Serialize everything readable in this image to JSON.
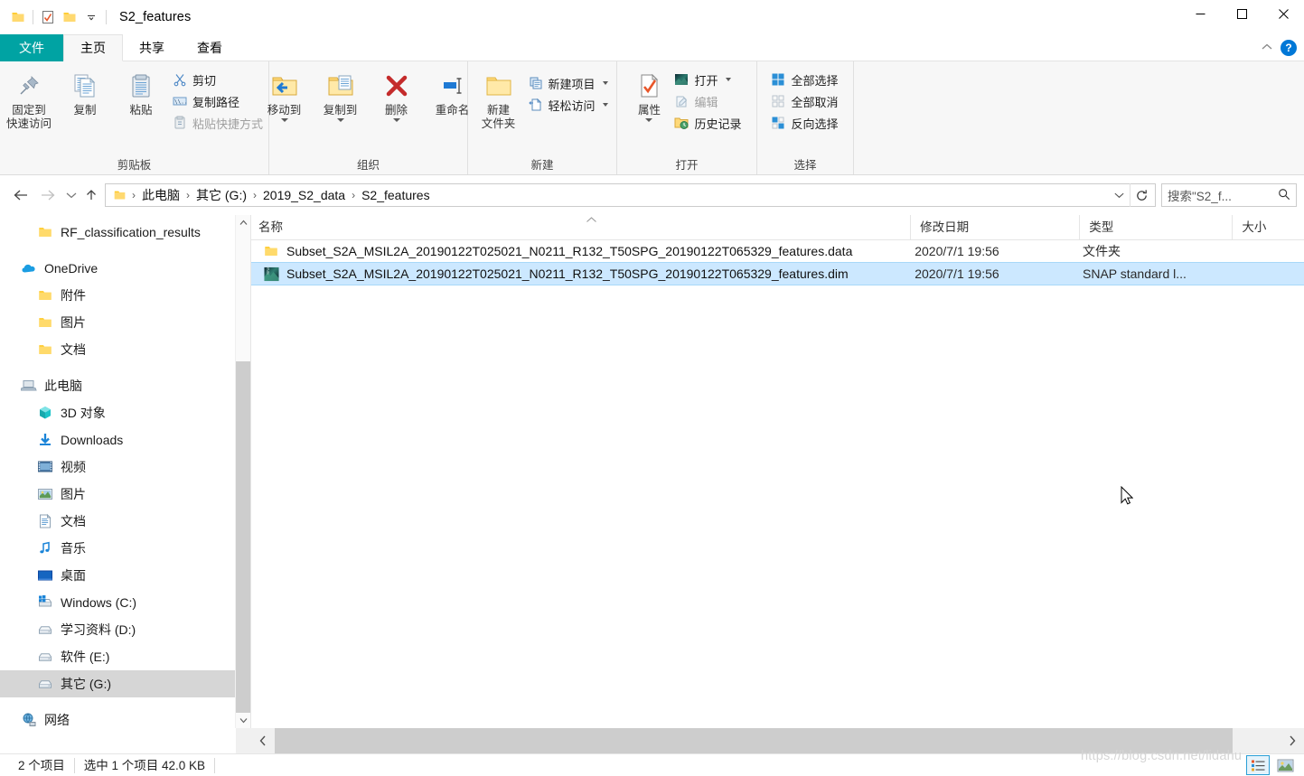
{
  "window": {
    "title": "S2_features",
    "quick_access": [
      "folder-icon",
      "properties-check-icon",
      "new-folder-icon",
      "dropdown-caret"
    ],
    "minimize_label": "—",
    "maximize_label": "□",
    "close_label": "✕",
    "collapse_ribbon_label": "⌃",
    "help_label": "?"
  },
  "tabs": [
    {
      "label": "文件",
      "kind": "file"
    },
    {
      "label": "主页",
      "kind": "active"
    },
    {
      "label": "共享",
      "kind": "normal"
    },
    {
      "label": "查看",
      "kind": "normal"
    }
  ],
  "ribbon": {
    "groups": [
      {
        "title": "剪贴板",
        "big": [
          {
            "label": "固定到\n快速访问",
            "label_line1": "固定到",
            "label_line2": "快速访问",
            "icon": "pin-icon"
          },
          {
            "label": "复制",
            "icon": "copy-icon"
          },
          {
            "label": "粘贴",
            "icon": "paste-icon"
          }
        ],
        "small": [
          {
            "label": "剪切",
            "icon": "scissors-icon",
            "disabled": false
          },
          {
            "label": "复制路径",
            "icon": "copy-path-icon",
            "disabled": false
          },
          {
            "label": "粘贴快捷方式",
            "icon": "paste-shortcut-icon",
            "disabled": true
          }
        ]
      },
      {
        "title": "组织",
        "big": [
          {
            "label": "移动到",
            "icon": "move-to-icon",
            "caret": true
          },
          {
            "label": "复制到",
            "icon": "copy-to-icon",
            "caret": true
          },
          {
            "label": "删除",
            "icon": "delete-icon",
            "caret": true
          },
          {
            "label": "重命名",
            "icon": "rename-icon",
            "caret": false
          }
        ],
        "small": []
      },
      {
        "title": "新建",
        "big": [
          {
            "label_line1": "新建",
            "label_line2": "文件夹",
            "icon": "new-folder-icon"
          }
        ],
        "small": [
          {
            "label": "新建项目",
            "icon": "new-item-icon",
            "caret": true
          },
          {
            "label": "轻松访问",
            "icon": "easy-access-icon",
            "caret": true
          }
        ]
      },
      {
        "title": "打开",
        "big": [
          {
            "label": "属性",
            "icon": "properties-icon",
            "caret": true
          }
        ],
        "small": [
          {
            "label": "打开",
            "icon": "snap-open-icon",
            "caret": true
          },
          {
            "label": "编辑",
            "icon": "edit-icon",
            "disabled": true
          },
          {
            "label": "历史记录",
            "icon": "history-icon"
          }
        ]
      },
      {
        "title": "选择",
        "big": [],
        "small": [
          {
            "label": "全部选择",
            "icon": "select-all-icon"
          },
          {
            "label": "全部取消",
            "icon": "select-none-icon"
          },
          {
            "label": "反向选择",
            "icon": "invert-selection-icon"
          }
        ]
      }
    ]
  },
  "address": {
    "back_label": "←",
    "forward_label": "→",
    "recent_label": "⌄",
    "up_label": "↑",
    "breadcrumbs": [
      "此电脑",
      "其它 (G:)",
      "2019_S2_data",
      "S2_features"
    ],
    "separator": "›",
    "dropdown_label": "⌄",
    "refresh_label": "↻",
    "search_placeholder": "搜索\"S2_f...",
    "search_value": ""
  },
  "sidebar": {
    "items": [
      {
        "label": "RF_classification_results",
        "icon": "folder-icon",
        "indent": 1,
        "selected": false,
        "gap_after": true
      },
      {
        "label": "OneDrive",
        "icon": "onedrive-icon",
        "indent": 0,
        "selected": false
      },
      {
        "label": "附件",
        "icon": "folder-icon",
        "indent": 1,
        "selected": false
      },
      {
        "label": "图片",
        "icon": "folder-icon",
        "indent": 1,
        "selected": false
      },
      {
        "label": "文档",
        "icon": "folder-icon",
        "indent": 1,
        "selected": false,
        "gap_after": true
      },
      {
        "label": "此电脑",
        "icon": "this-pc-icon",
        "indent": 0,
        "selected": false
      },
      {
        "label": "3D 对象",
        "icon": "3d-objects-icon",
        "indent": 1,
        "selected": false
      },
      {
        "label": "Downloads",
        "icon": "downloads-icon",
        "indent": 1,
        "selected": false
      },
      {
        "label": "视频",
        "icon": "videos-icon",
        "indent": 1,
        "selected": false
      },
      {
        "label": "图片",
        "icon": "pictures-icon",
        "indent": 1,
        "selected": false
      },
      {
        "label": "文档",
        "icon": "documents-icon",
        "indent": 1,
        "selected": false
      },
      {
        "label": "音乐",
        "icon": "music-icon",
        "indent": 1,
        "selected": false
      },
      {
        "label": "桌面",
        "icon": "desktop-icon",
        "indent": 1,
        "selected": false
      },
      {
        "label": "Windows (C:)",
        "icon": "windows-drive-icon",
        "indent": 1,
        "selected": false
      },
      {
        "label": "学习资料 (D:)",
        "icon": "drive-icon",
        "indent": 1,
        "selected": false
      },
      {
        "label": "软件 (E:)",
        "icon": "drive-icon",
        "indent": 1,
        "selected": false
      },
      {
        "label": "其它 (G:)",
        "icon": "drive-icon",
        "indent": 1,
        "selected": true,
        "gap_after": true
      },
      {
        "label": "网络",
        "icon": "network-icon",
        "indent": 0,
        "selected": false
      }
    ]
  },
  "filelist": {
    "columns": [
      {
        "key": "name",
        "label": "名称"
      },
      {
        "key": "date",
        "label": "修改日期"
      },
      {
        "key": "type",
        "label": "类型"
      },
      {
        "key": "size",
        "label": "大小"
      }
    ],
    "sort_indicator": "⌃",
    "rows": [
      {
        "name": "Subset_S2A_MSIL2A_20190122T025021_N0211_R132_T50SPG_20190122T065329_features.data",
        "date": "2020/7/1 19:56",
        "type": "文件夹",
        "size": "",
        "icon": "folder-icon",
        "selected": false
      },
      {
        "name": "Subset_S2A_MSIL2A_20190122T025021_N0211_R132_T50SPG_20190122T065329_features.dim",
        "date": "2020/7/1 19:56",
        "type": "SNAP standard l...",
        "size": "",
        "icon": "snap-file-icon",
        "selected": true
      }
    ]
  },
  "statusbar": {
    "item_count": "2 个项目",
    "selection_info": "选中 1 个项目  42.0 KB",
    "view_details_label": "details-view-icon",
    "view_large_label": "large-icons-view-icon"
  },
  "watermark": {
    "text": "https://blog.csdn.net/lidahu"
  },
  "colors": {
    "file_tab": "#00a3a3",
    "selection": "#cce8ff",
    "sidebar_selection": "#d6d6d6",
    "ribbon_bg": "#f7f7f7",
    "accent": "#0078d7",
    "folder_yellow": "#ffd149"
  }
}
